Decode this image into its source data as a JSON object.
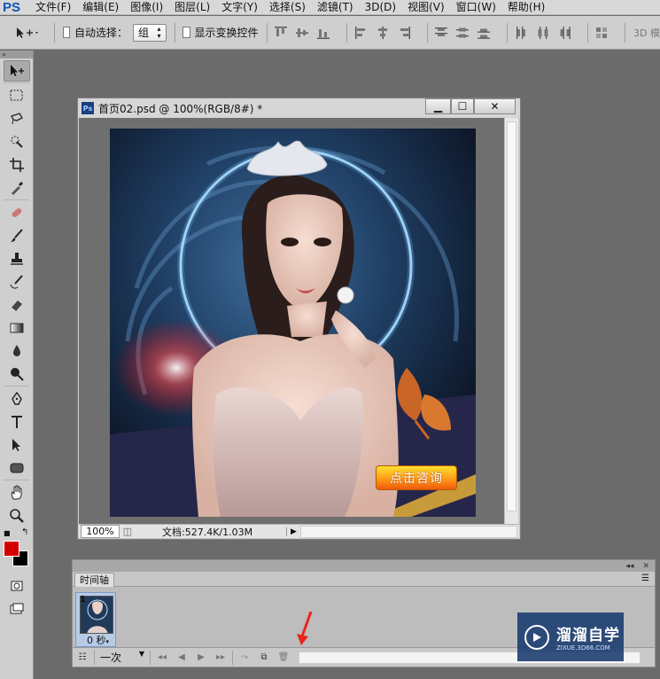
{
  "app": {
    "logo": "PS"
  },
  "menu": [
    "文件(F)",
    "编辑(E)",
    "图像(I)",
    "图层(L)",
    "文字(Y)",
    "选择(S)",
    "滤镜(T)",
    "3D(D)",
    "视图(V)",
    "窗口(W)",
    "帮助(H)"
  ],
  "options": {
    "auto_select_label": "自动选择：",
    "auto_select_value": "组",
    "show_transform_label": "显示变换控件",
    "mode_3d": "3D 模"
  },
  "document": {
    "title": "首页02.psd @ 100%(RGB/8#) *",
    "zoom": "100%",
    "doc_info": "文档:527.4K/1.03M",
    "cta_text": "点击咨询",
    "ps_badge": "Ps"
  },
  "timeline": {
    "tab_label": "时间轴",
    "frame_number": "1",
    "frame_delay": "0 秒",
    "loop_mode": "一次"
  },
  "watermark": {
    "title": "溜溜自学",
    "url": "ZIXUE.3D66.COM"
  },
  "colors": {
    "foreground": "#d40000",
    "background": "#000000",
    "accent_arrow": "#e8261c"
  }
}
